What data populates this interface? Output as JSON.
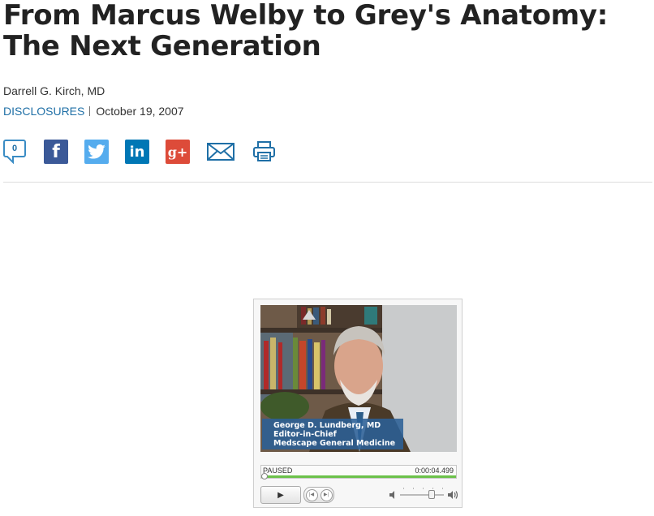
{
  "article": {
    "title": "From Marcus Welby to Grey's Anatomy: The Next Generation",
    "author": "Darrell G. Kirch, MD",
    "disclosures_label": "DISCLOSURES",
    "date": "October 19, 2007"
  },
  "share": {
    "comment_count": "0",
    "icons": [
      "comment-icon",
      "facebook-icon",
      "twitter-icon",
      "linkedin-icon",
      "google-plus-icon",
      "email-icon",
      "print-icon"
    ],
    "facebook_glyph": "f",
    "linkedin_glyph": "in",
    "googleplus_glyph": "g+",
    "colors": {
      "facebook": "#3b5998",
      "twitter": "#55acee",
      "linkedin": "#0077b5",
      "googleplus": "#dd4b39",
      "link": "#1f6fa6"
    }
  },
  "player": {
    "lower_third": {
      "name": "George D. Lundberg, MD",
      "role": "Editor-in-Chief",
      "org": "Medscape General Medicine"
    },
    "status": "PAUSED",
    "time": "0:00:04.499",
    "progress": 0.0,
    "volume": 0.72,
    "play_glyph": "▶",
    "prev_glyph": "|◀",
    "next_glyph": "▶|",
    "colors": {
      "progress_fill": "#6cc24a",
      "caption_bg": "#2b6096"
    }
  }
}
